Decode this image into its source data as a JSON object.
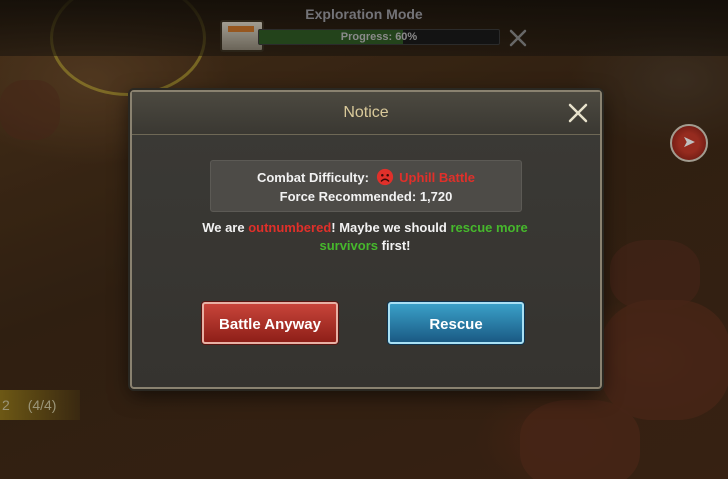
{
  "top_bar": {
    "mode_title": "Exploration Mode",
    "progress_text": "Progress: 60%",
    "progress_value": 0.6
  },
  "left_tab": {
    "partial_text": "2",
    "count_text": "(4/4)"
  },
  "dialog": {
    "title": "Notice",
    "difficulty_label": "Combat Difficulty:",
    "difficulty_value": "Uphill Battle",
    "force_label": "Force Recommended:",
    "force_value": "1,720",
    "message": {
      "part1": "We are ",
      "red_word": "outnumbered",
      "part2": "! Maybe we should ",
      "green_words": "rescue more survivors",
      "part3": " first!"
    },
    "battle_button": "Battle Anyway",
    "rescue_button": "Rescue"
  },
  "colors": {
    "danger": "#e0302a",
    "positive": "#46b82c",
    "title_gold": "#d9c99a"
  },
  "icons": {
    "difficulty": "sad-face-icon",
    "close": "close-icon",
    "side_button": "cannon-icon"
  }
}
